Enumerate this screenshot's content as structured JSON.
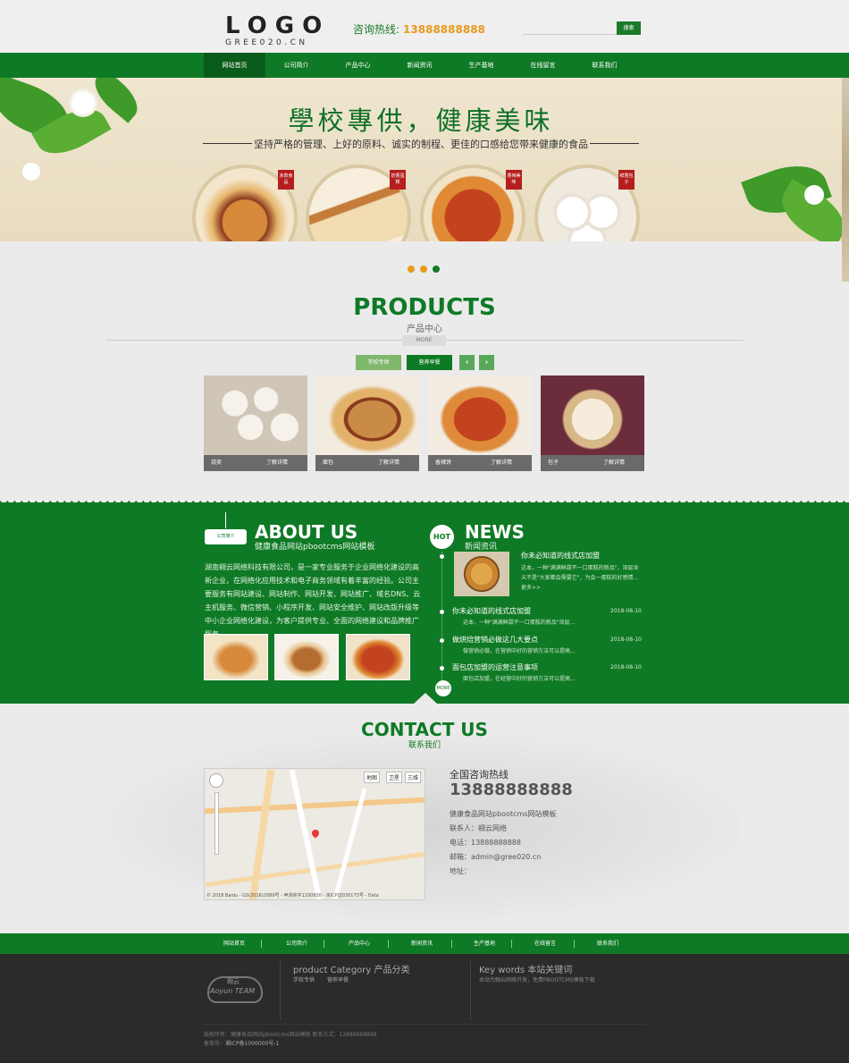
{
  "header": {
    "logo_text": "LOGO",
    "logo_sub": "GREE020.CN",
    "hotline_label": "咨询热线:",
    "hotline_number": "13888888888",
    "search_button": "搜索"
  },
  "nav": {
    "items": [
      "网站首页",
      "公司简介",
      "产品中心",
      "新闻资讯",
      "生产基地",
      "在线留言",
      "联系我们"
    ]
  },
  "banner": {
    "title": "學校專供，健康美味",
    "subtitle": "坚持严格的管理、上好的原料、诚实的制程、更佳的口感给您带来健康的食品",
    "tags": [
      "多款食品",
      "奶香蛋糕",
      "香辣美味",
      "鲜香包子"
    ]
  },
  "products": {
    "title": "PRODUCTS",
    "subtitle": "产品中心",
    "more_label": "MORE",
    "tabs": [
      "学校专供",
      "营养早餐"
    ],
    "items": [
      {
        "name": "烧卖",
        "action": "了解详情"
      },
      {
        "name": "面包",
        "action": "了解详情"
      },
      {
        "name": "香辣饼",
        "action": "了解详情"
      },
      {
        "name": "包子",
        "action": "了解详情"
      }
    ]
  },
  "about": {
    "badge": "公司简介",
    "title": "ABOUT US",
    "subtitle": "健康食品网站pbootcms网站模板",
    "text": "湖南翱云网络科技有限公司，是一家专业服务于企业网络化建设的高新企业，在网络化应用技术和电子商务领域有着丰富的经验。公司主要服务有网站建设、网站制作、网站开发、网站推广、域名DNS、云主机服务、微信营销、小程序开发、网站安全维护、网站改版升级等中小企业网络化建设，为客户提供专业、全面的网络建设和品牌推广服务。"
  },
  "news": {
    "hot": "HOT",
    "title": "NEWS",
    "subtitle": "新闻资讯",
    "more": "MORE",
    "featured": {
      "title": "你未必知道的线式店加盟",
      "summary": "这本，一种\"满满鲜甜不一口蛋糕的新品\"，深层含义不是\"大家都会需要它\"，为会一蛋糕的好感情...更多>>"
    },
    "items": [
      {
        "title": "你未必知道的线式店加盟",
        "date": "2018-08-10",
        "summary": "这本，一种\"满满鲜甜不一口蛋糕的新品\"深层..."
      },
      {
        "title": "做烘焙营销必做这几大要点",
        "date": "2018-08-10",
        "summary": "做营销必做，在营销中好的营销方法可以提高..."
      },
      {
        "title": "面包店加盟的运营注意事项",
        "date": "2018-08-10",
        "summary": "面包店加盟，在经营中好的营销方法可以提高..."
      }
    ]
  },
  "contact": {
    "title": "CONTACT US",
    "subtitle": "联系我们",
    "hotline_label": "全国咨询热线",
    "hotline_number": "13888888888",
    "company": "健康食品网站pbootcms网站模板",
    "contact_person": "联系人：翱云网络",
    "phone": "电话：13888888888",
    "email": "邮箱：admin@gree020.cn",
    "address": "地址：",
    "map_buttons": [
      "地图",
      "卫星",
      "三维"
    ],
    "map_footer": "© 2018 Baidu - GS(2016)2089号 - 甲测资字1100930 - 京ICP证030173号 - Data"
  },
  "footer": {
    "nav": [
      "网站首页",
      "公司简介",
      "产品中心",
      "新闻资讯",
      "生产基地",
      "在线留言",
      "联系我们"
    ],
    "logo_text": "Aoyun TEAM",
    "logo_cn": "翱云",
    "category_title": "product Category 产品分类",
    "categories": [
      "学校专供",
      "营养早餐"
    ],
    "keywords_title": "Key words 本站关键词",
    "keywords_text": "本站为翱云网络开发，免费PBOOTCMS模板下载",
    "copyright": "版权所有：健康食品网站pbootcms网站模板 联系方式：13888888888",
    "icp_label": "备案号：",
    "icp": "湘ICP备1000000号-1"
  },
  "colors": {
    "brand_green": "#0f7a25",
    "accent_orange": "#e89a1c",
    "footer_dark": "#2b2b2b"
  }
}
